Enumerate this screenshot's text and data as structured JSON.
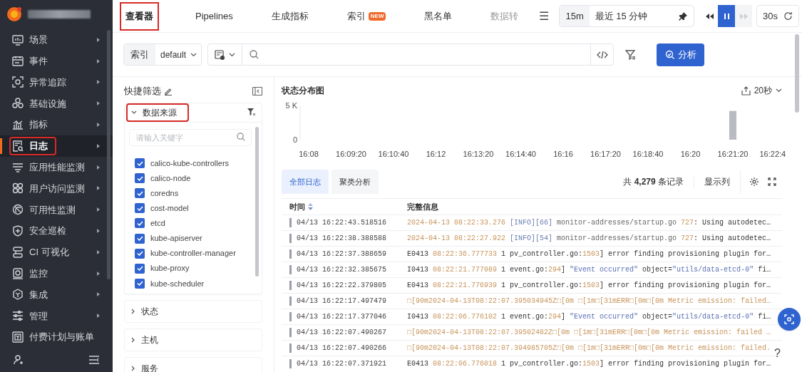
{
  "sidebar": {
    "items": [
      {
        "label": "场景",
        "selected": false,
        "highlighted": false,
        "arrow": true
      },
      {
        "label": "事件",
        "selected": false,
        "highlighted": false,
        "arrow": true
      },
      {
        "label": "异常追踪",
        "selected": false,
        "highlighted": false,
        "arrow": true
      },
      {
        "label": "基础设施",
        "selected": false,
        "highlighted": false,
        "arrow": true
      },
      {
        "label": "指标",
        "selected": false,
        "highlighted": false,
        "arrow": true
      },
      {
        "label": "日志",
        "selected": true,
        "highlighted": true,
        "arrow": true
      },
      {
        "label": "应用性能监测",
        "selected": false,
        "highlighted": false,
        "arrow": true
      },
      {
        "label": "用户访问监测",
        "selected": false,
        "highlighted": false,
        "arrow": true
      },
      {
        "label": "可用性监测",
        "selected": false,
        "highlighted": false,
        "arrow": true
      },
      {
        "label": "安全巡检",
        "selected": false,
        "highlighted": false,
        "arrow": true
      },
      {
        "label": "CI 可视化",
        "selected": false,
        "highlighted": false,
        "arrow": true
      },
      {
        "label": "监控",
        "selected": false,
        "highlighted": false,
        "arrow": true
      },
      {
        "label": "集成",
        "selected": false,
        "highlighted": false,
        "arrow": true
      },
      {
        "label": "管理",
        "selected": false,
        "highlighted": false,
        "arrow": true
      },
      {
        "label": "付费计划与账单",
        "selected": false,
        "highlighted": false,
        "arrow": false
      }
    ]
  },
  "tabs": [
    {
      "label": "查看器",
      "selected": true,
      "highlighted": true
    },
    {
      "label": "Pipelines",
      "selected": false,
      "highlighted": false
    },
    {
      "label": "生成指标",
      "selected": false,
      "highlighted": false
    },
    {
      "label": "索引",
      "selected": false,
      "highlighted": false,
      "badge": "NEW"
    },
    {
      "label": "黑名单",
      "selected": false,
      "highlighted": false
    },
    {
      "label": "数据转",
      "selected": false,
      "highlighted": false,
      "faded": true
    }
  ],
  "menu_icon": "☰",
  "time_range": {
    "short": "15m",
    "label": "最近 15 分钟",
    "refresh": "30s"
  },
  "playback": [
    {
      "kind": "rewind",
      "selected": false,
      "disabled": false
    },
    {
      "kind": "pause",
      "selected": true,
      "disabled": false
    },
    {
      "kind": "forward",
      "selected": false,
      "disabled": true
    }
  ],
  "query": {
    "index_label": "索引",
    "index_value": "default",
    "analyze_button": "分析"
  },
  "filters": {
    "title": "快捷筛选",
    "groups": [
      {
        "label": "数据来源",
        "expanded": true,
        "highlighted": true,
        "placeholder": "请输入关键字",
        "options": [
          {
            "label": "calico-kube-controllers",
            "checked": true
          },
          {
            "label": "calico-node",
            "checked": true
          },
          {
            "label": "coredns",
            "checked": true
          },
          {
            "label": "cost-model",
            "checked": true
          },
          {
            "label": "etcd",
            "checked": true
          },
          {
            "label": "kube-apiserver",
            "checked": true
          },
          {
            "label": "kube-controller-manager",
            "checked": true
          },
          {
            "label": "kube-proxy",
            "checked": true
          },
          {
            "label": "kube-scheduler",
            "checked": true
          }
        ]
      },
      {
        "label": "状态",
        "expanded": false,
        "highlighted": false
      },
      {
        "label": "主机",
        "expanded": false,
        "highlighted": false
      },
      {
        "label": "服务",
        "expanded": false,
        "highlighted": false
      }
    ]
  },
  "chart": {
    "title": "状态分布图",
    "interval": "20秒",
    "chart_data": {
      "type": "bar",
      "categories": [
        "16:08",
        "16:09:20",
        "16:10:40",
        "16:12",
        "16:13:20",
        "16:14:40",
        "16:16",
        "16:17:20",
        "16:18:40",
        "16:20",
        "16:21:20",
        "16:22:4"
      ],
      "values": [
        0,
        0,
        0,
        0,
        0,
        0,
        0,
        0,
        0,
        0,
        4200,
        0
      ],
      "ylim": [
        0,
        5000
      ],
      "yticks": [
        0,
        {
          "value": 5000,
          "label": "5 K"
        }
      ]
    }
  },
  "log_tabs": [
    {
      "label": "全部日志",
      "selected": true
    },
    {
      "label": "聚类分析",
      "selected": false
    }
  ],
  "record_count": "共 **4,279** 条记录",
  "columns_button": "显示列",
  "table": {
    "columns": [
      "时间",
      "完整信息"
    ],
    "rows": [
      {
        "time": "04/13 16:22:43.518516",
        "message": [
          {
            "kind": "time",
            "text": "2024-04-13 08:22:33.276"
          },
          {
            "kind": "tag",
            "text": " [INFO][66] "
          },
          {
            "kind": "muted",
            "text": "monitor-addresses/startup.go "
          },
          {
            "kind": "time",
            "text": "727"
          },
          {
            "kind": "plain",
            "text": ": Using autodetec…"
          }
        ]
      },
      {
        "time": "04/13 16:22:38.388588",
        "message": [
          {
            "kind": "time",
            "text": "2024-04-13 08:22:27.922"
          },
          {
            "kind": "tag",
            "text": " [INFO][54] "
          },
          {
            "kind": "muted",
            "text": "monitor-addresses/startup.go "
          },
          {
            "kind": "time",
            "text": "727"
          },
          {
            "kind": "plain",
            "text": ": Using autodetec…"
          }
        ]
      },
      {
        "time": "04/13 16:22:37.388659",
        "message": [
          {
            "kind": "plain",
            "text": "E0413 "
          },
          {
            "kind": "time",
            "text": "08:22:36.777733"
          },
          {
            "kind": "plain",
            "text": " 1 pv_controller.go:"
          },
          {
            "kind": "time",
            "text": "1503"
          },
          {
            "kind": "plain",
            "text": "] error finding provisioning plugin for…"
          }
        ]
      },
      {
        "time": "04/13 16:22:32.385675",
        "message": [
          {
            "kind": "plain",
            "text": "I0413 "
          },
          {
            "kind": "time",
            "text": "08:22:21.777089"
          },
          {
            "kind": "plain",
            "text": " 1 event.go:"
          },
          {
            "kind": "time",
            "text": "294"
          },
          {
            "kind": "plain",
            "text": "] "
          },
          {
            "kind": "string",
            "text": "\"Event occurred\""
          },
          {
            "kind": "plain",
            "text": " object="
          },
          {
            "kind": "string",
            "text": "\"utils/data-etcd-0\""
          },
          {
            "kind": "plain",
            "text": " fi…"
          }
        ]
      },
      {
        "time": "04/13 16:22:22.379805",
        "message": [
          {
            "kind": "plain",
            "text": "E0413 "
          },
          {
            "kind": "time",
            "text": "08:22:21.776939"
          },
          {
            "kind": "plain",
            "text": " 1 pv_controller.go:"
          },
          {
            "kind": "time",
            "text": "1503"
          },
          {
            "kind": "plain",
            "text": "] error finding provisioning plugin for…"
          }
        ]
      },
      {
        "time": "04/13 16:22:17.497479",
        "message": [
          {
            "kind": "time",
            "text": "□[90m2024-04-13T08:22:07.395034945Z□[0m □[1m□[31mERR□[0m□[0m Metric emission: failed…"
          }
        ]
      },
      {
        "time": "04/13 16:22:17.377046",
        "message": [
          {
            "kind": "plain",
            "text": "I0413 "
          },
          {
            "kind": "time",
            "text": "08:22:06.776102"
          },
          {
            "kind": "plain",
            "text": " 1 event.go:"
          },
          {
            "kind": "time",
            "text": "294"
          },
          {
            "kind": "plain",
            "text": "] "
          },
          {
            "kind": "string",
            "text": "\"Event occurred\""
          },
          {
            "kind": "plain",
            "text": " object="
          },
          {
            "kind": "string",
            "text": "\"utils/data-etcd-0\""
          },
          {
            "kind": "plain",
            "text": " fi…"
          }
        ]
      },
      {
        "time": "04/13 16:22:07.490267",
        "message": [
          {
            "kind": "time",
            "text": "□[90m2024-04-13T08:22:07.39502482Z□[0m □[1m□[31mERR□[0m□[0m Metric emission: failed …"
          }
        ]
      },
      {
        "time": "04/13 16:22:07.490266",
        "message": [
          {
            "kind": "time",
            "text": "□[90m2024-04-13T08:22:07.394985705Z□[0m □[1m□[31mERR□[0m□[0m Metric emission: failed."
          }
        ]
      },
      {
        "time": "04/13 16:22:07.371921",
        "message": [
          {
            "kind": "plain",
            "text": "E0413 "
          },
          {
            "kind": "time",
            "text": "08:22:06.776018"
          },
          {
            "kind": "plain",
            "text": " 1 pv_controller.go:"
          },
          {
            "kind": "time",
            "text": "1503"
          },
          {
            "kind": "plain",
            "text": "] error finding provisioning plugin for…"
          }
        ]
      }
    ]
  },
  "help": "?"
}
